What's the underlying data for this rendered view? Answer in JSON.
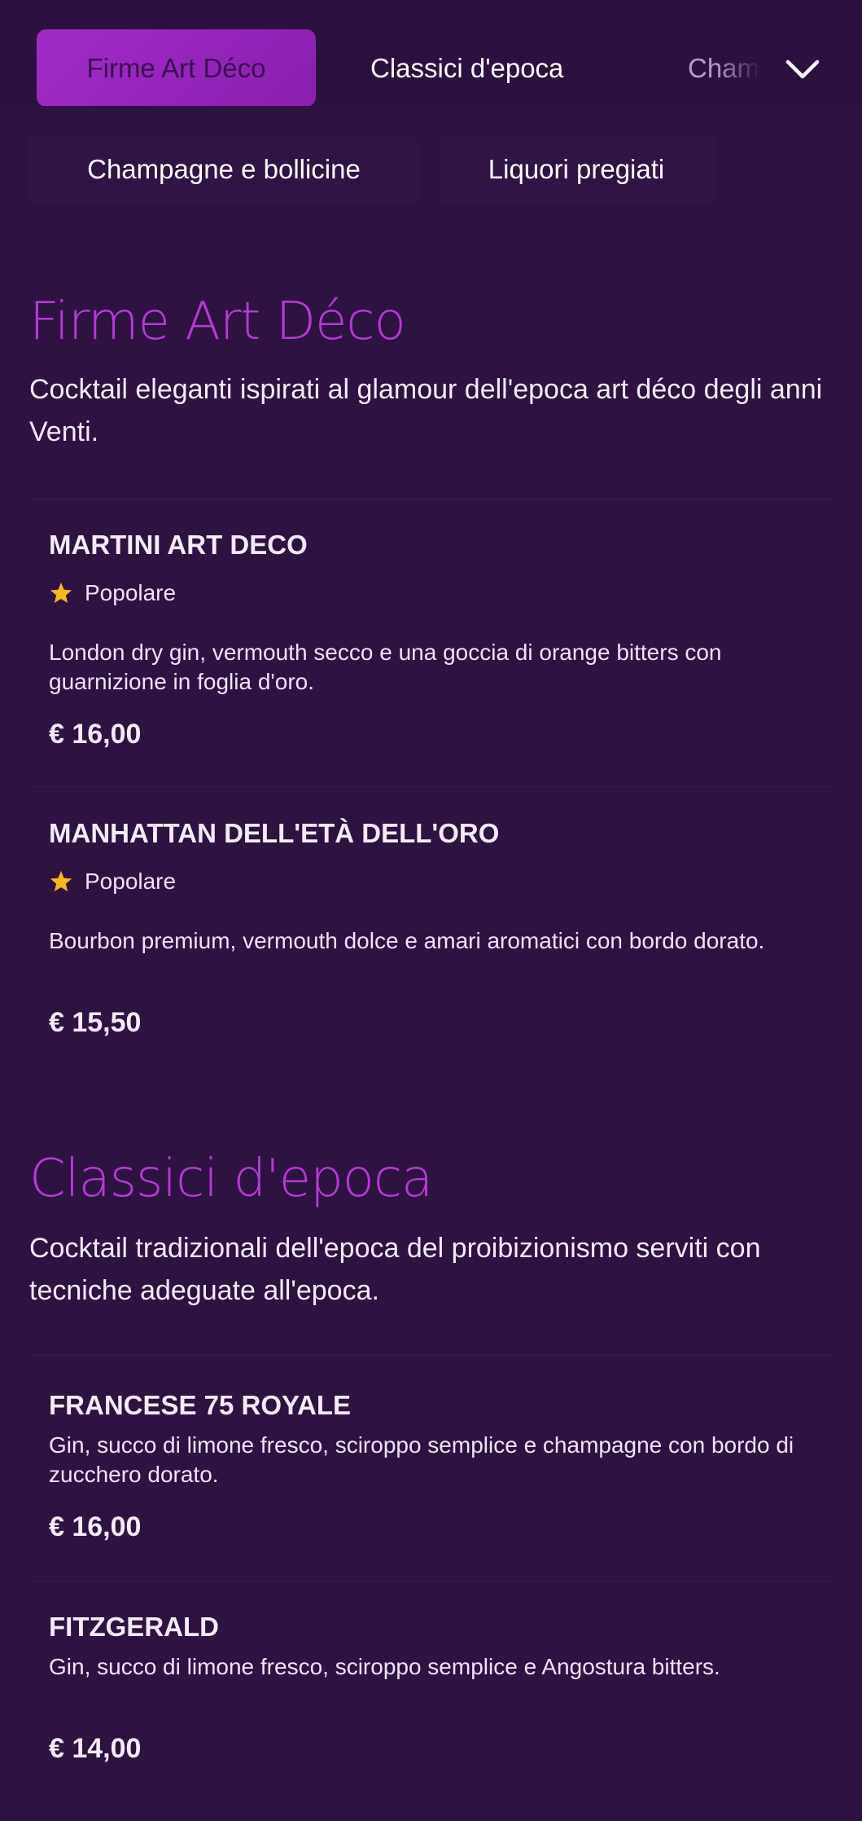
{
  "nav": {
    "tabs": [
      {
        "label": "Firme Art Déco",
        "active": true
      },
      {
        "label": "Classici d'epoca",
        "active": false
      },
      {
        "label": "Champagne e bollicine",
        "active": false
      }
    ],
    "overflow_tabs": [
      {
        "label": "Champagne e bollicine"
      },
      {
        "label": "Liquori pregiati"
      }
    ],
    "expand_icon": "chevron-down-icon"
  },
  "colors": {
    "background": "#2e1242",
    "accent": "#b63ad4",
    "active_tab": "#a22bc7",
    "star": "#f5b820"
  },
  "sections": [
    {
      "title": "Firme Art Déco",
      "description": "Cocktail eleganti ispirati al glamour dell'epoca art déco degli anni Venti.",
      "items": [
        {
          "name": "MARTINI ART DECO",
          "badge": "Popolare",
          "badge_icon": "star-icon",
          "description": "London dry gin, vermouth secco e una goccia di orange bitters con guarnizione in foglia d'oro.",
          "price": "€ 16,00"
        },
        {
          "name": "MANHATTAN DELL'ETÀ DELL'ORO",
          "badge": "Popolare",
          "badge_icon": "star-icon",
          "description": "Bourbon premium, vermouth dolce e amari aromatici con bordo dorato.",
          "price": "€ 15,50"
        }
      ]
    },
    {
      "title": "Classici d'epoca",
      "description": "Cocktail tradizionali dell'epoca del proibizionismo serviti con tecniche adeguate all'epoca.",
      "items": [
        {
          "name": "FRANCESE 75 ROYALE",
          "description": "Gin, succo di limone fresco, sciroppo semplice e champagne con bordo di zucchero dorato.",
          "price": "€ 16,00"
        },
        {
          "name": "FITZGERALD",
          "description": "Gin, succo di limone fresco, sciroppo semplice e Angostura bitters.",
          "price": "€ 14,00"
        }
      ]
    }
  ]
}
